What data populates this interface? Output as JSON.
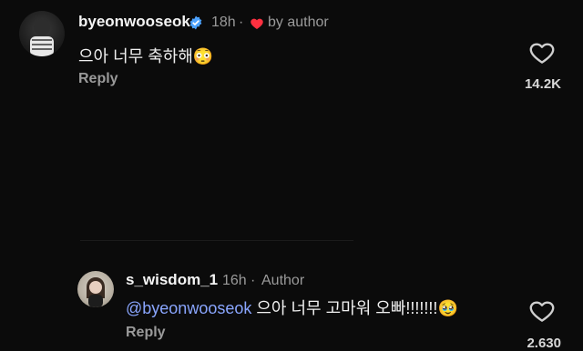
{
  "comments": [
    {
      "username": "byeonwooseok",
      "verified": true,
      "time": "18h",
      "separator": "·",
      "liked_by_author_text": "by author",
      "text": "으아 너무 축하해",
      "emoji": "😳",
      "reply_label": "Reply",
      "likes": "14.2K",
      "icons": {
        "verified": "verified-badge",
        "liked": "heart",
        "like": "heart-outline"
      },
      "colors": {
        "verified": "#4da3ff",
        "liked_heart": "#ff3040"
      }
    },
    {
      "username": "s_wisdom_1",
      "time": "16h",
      "separator": "·",
      "author_label": "Author",
      "mention": "@byeonwooseok",
      "text": "으아 너무 고마워 오빠!!!!!!!",
      "emoji": "🥹",
      "reply_label": "Reply",
      "likes": "2.630",
      "icons": {
        "like": "heart-outline"
      },
      "colors": {
        "mention": "#8aa6ff"
      }
    }
  ]
}
